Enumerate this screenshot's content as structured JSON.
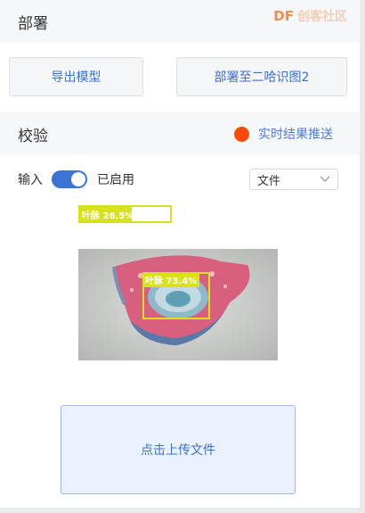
{
  "deploy": {
    "title": "部署",
    "export_button": "导出模型",
    "deploy_button": "部署至二哈识图2"
  },
  "watermark": {
    "logo": "DF",
    "text": "创客社区"
  },
  "verify": {
    "title": "校验",
    "push_label": "实时结果推送",
    "push_dot_color": "#ff4a06"
  },
  "input": {
    "label": "输入",
    "toggle_on": true,
    "toggle_status": "已启用",
    "source_select": "文件"
  },
  "result": {
    "confidence_label": "叶脉 26.5%",
    "confidence_value": 0.265,
    "detection_label": "叶脉 73.4%",
    "detection_color": "#d7e21c"
  },
  "upload": {
    "label": "点击上传文件"
  },
  "colors": {
    "accent": "#3e73d6",
    "link": "#3b6fd8",
    "header_bg": "#f6f7f9"
  }
}
